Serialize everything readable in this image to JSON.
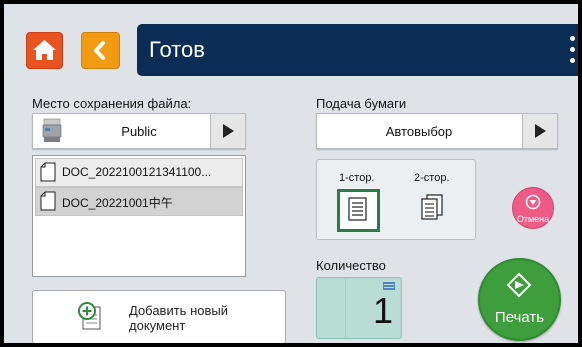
{
  "header": {
    "title": "Готов"
  },
  "save_location": {
    "label": "Место сохранения файла:",
    "value": "Public"
  },
  "files": [
    "DOC_2022100121341100...",
    "DOC_20221001中午"
  ],
  "add_document": {
    "label_line1": "Добавить новый",
    "label_line2": "документ"
  },
  "paper_feed": {
    "label": "Подача бумаги",
    "value": "Автовыбор"
  },
  "duplex": {
    "one_sided": "1-стор.",
    "two_sided": "2-стор."
  },
  "cancel": {
    "label": "Отмена"
  },
  "quantity": {
    "label": "Количество",
    "value": "1"
  },
  "print": {
    "label": "Печать"
  },
  "colors": {
    "title_bar": "#0b2c55",
    "home_button": "#e9531f",
    "back_button": "#f29a12",
    "print_button": "#3d9e3b",
    "cancel_button": "#ef5b86",
    "quantity_box": "#b9dcd4"
  }
}
